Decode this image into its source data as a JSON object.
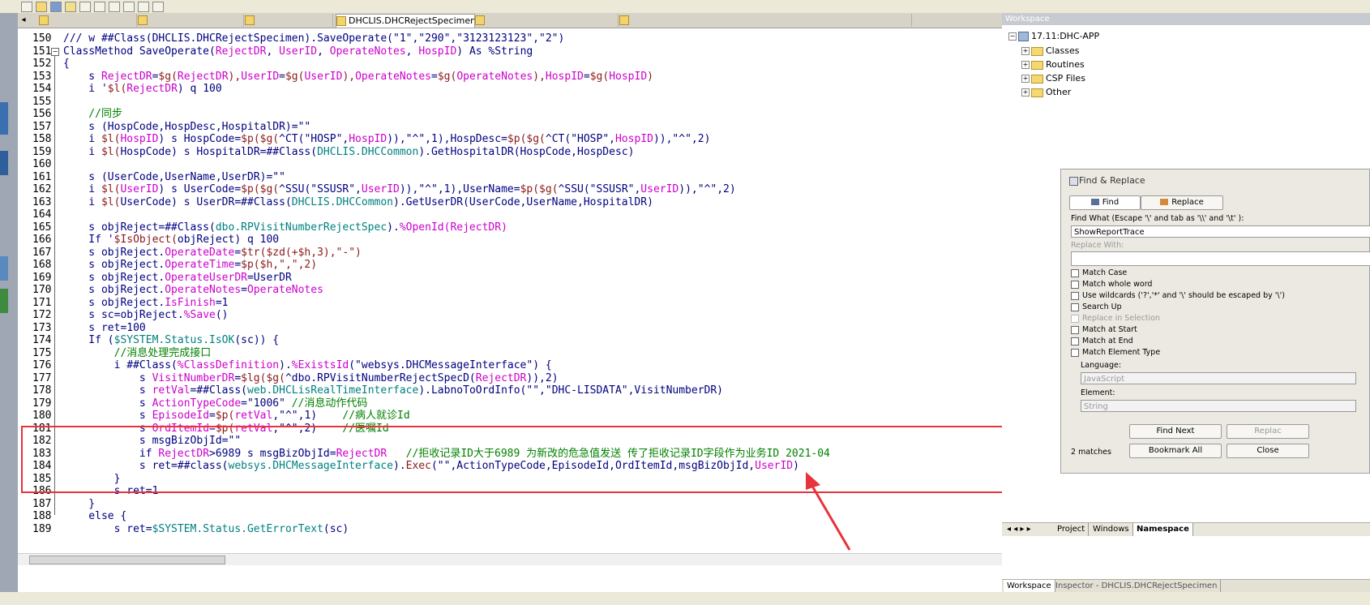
{
  "editor": {
    "tabs": [
      "",
      "",
      "",
      "DHCLIS.DHCRejectSpecimen.cls",
      "",
      ""
    ],
    "tab_arrows": "▸ ×",
    "lines": [
      {
        "n": "150",
        "segs": [
          [
            "/// w ##Class(DHCLIS.DHCRejectSpecimen).SaveOperate(\"1\",\"290\",\"3123123123\",\"2\")",
            "kw"
          ]
        ]
      },
      {
        "n": "151",
        "segs": [
          [
            "ClassMethod SaveOperate(",
            "kw"
          ],
          [
            "RejectDR",
            "var"
          ],
          [
            ", ",
            "kw"
          ],
          [
            "UserID",
            "var"
          ],
          [
            ", ",
            "kw"
          ],
          [
            "OperateNotes",
            "var"
          ],
          [
            ", ",
            "kw"
          ],
          [
            "HospID",
            "var"
          ],
          [
            ") As %String",
            "kw"
          ]
        ]
      },
      {
        "n": "152",
        "segs": [
          [
            "{",
            "kw"
          ]
        ]
      },
      {
        "n": "153",
        "segs": [
          [
            "    s ",
            "kw"
          ],
          [
            "RejectDR",
            "var"
          ],
          [
            "=",
            "kw"
          ],
          [
            "$g(",
            "fn"
          ],
          [
            "RejectDR",
            "var"
          ],
          [
            "),",
            "fn"
          ],
          [
            "UserID",
            "var"
          ],
          [
            "=",
            "kw"
          ],
          [
            "$g(",
            "fn"
          ],
          [
            "UserID",
            "var"
          ],
          [
            "),",
            "fn"
          ],
          [
            "OperateNotes",
            "var"
          ],
          [
            "=",
            "kw"
          ],
          [
            "$g(",
            "fn"
          ],
          [
            "OperateNotes",
            "var"
          ],
          [
            "),",
            "fn"
          ],
          [
            "HospID",
            "var"
          ],
          [
            "=",
            "kw"
          ],
          [
            "$g(",
            "fn"
          ],
          [
            "HospID",
            "var"
          ],
          [
            ")",
            "fn"
          ]
        ]
      },
      {
        "n": "154",
        "segs": [
          [
            "    i '",
            "kw"
          ],
          [
            "$l(",
            "fn"
          ],
          [
            "RejectDR",
            "var"
          ],
          [
            ") q 100",
            "kw"
          ]
        ]
      },
      {
        "n": "155",
        "segs": [
          [
            "",
            "kw"
          ]
        ]
      },
      {
        "n": "156",
        "segs": [
          [
            "    //同步",
            "cmt"
          ]
        ]
      },
      {
        "n": "157",
        "segs": [
          [
            "    s (HospCode,HospDesc,HospitalDR)=\"\"",
            "kw"
          ]
        ]
      },
      {
        "n": "158",
        "segs": [
          [
            "    i ",
            "kw"
          ],
          [
            "$l(",
            "fn"
          ],
          [
            "HospID",
            "var"
          ],
          [
            ") s HospCode=",
            "kw"
          ],
          [
            "$p($g(",
            "fn"
          ],
          [
            "^CT(\"HOSP\",",
            "kw"
          ],
          [
            "HospID",
            "var"
          ],
          [
            ")),\"^\",1),HospDesc=",
            "kw"
          ],
          [
            "$p($g(",
            "fn"
          ],
          [
            "^CT(\"HOSP\",",
            "kw"
          ],
          [
            "HospID",
            "var"
          ],
          [
            ")),\"^\",2)",
            "kw"
          ]
        ]
      },
      {
        "n": "159",
        "segs": [
          [
            "    i ",
            "kw"
          ],
          [
            "$l(",
            "fn"
          ],
          [
            "HospCode) s HospitalDR=##Class(",
            "kw"
          ],
          [
            "DHCLIS.DHCCommon",
            "cls"
          ],
          [
            ").GetHospitalDR(HospCode,HospDesc)",
            "kw"
          ]
        ]
      },
      {
        "n": "160",
        "segs": [
          [
            "",
            "kw"
          ]
        ]
      },
      {
        "n": "161",
        "segs": [
          [
            "    s (UserCode,UserName,UserDR)=\"\"",
            "kw"
          ]
        ]
      },
      {
        "n": "162",
        "segs": [
          [
            "    i ",
            "kw"
          ],
          [
            "$l(",
            "fn"
          ],
          [
            "UserID",
            "var"
          ],
          [
            ") s UserCode=",
            "kw"
          ],
          [
            "$p($g(",
            "fn"
          ],
          [
            "^SSU(\"SSUSR\",",
            "kw"
          ],
          [
            "UserID",
            "var"
          ],
          [
            ")),\"^\",1),UserName=",
            "kw"
          ],
          [
            "$p($g(",
            "fn"
          ],
          [
            "^SSU(\"SSUSR\",",
            "kw"
          ],
          [
            "UserID",
            "var"
          ],
          [
            ")),\"^\",2)",
            "kw"
          ]
        ]
      },
      {
        "n": "163",
        "segs": [
          [
            "    i ",
            "kw"
          ],
          [
            "$l(",
            "fn"
          ],
          [
            "UserCode) s UserDR=##Class(",
            "kw"
          ],
          [
            "DHCLIS.DHCCommon",
            "cls"
          ],
          [
            ").GetUserDR(UserCode,UserName,HospitalDR)",
            "kw"
          ]
        ]
      },
      {
        "n": "164",
        "segs": [
          [
            "",
            "kw"
          ]
        ]
      },
      {
        "n": "165",
        "segs": [
          [
            "    s objReject=##Class(",
            "kw"
          ],
          [
            "dbo.RPVisitNumberRejectSpec",
            "cls"
          ],
          [
            ").",
            "kw"
          ],
          [
            "%OpenId(",
            "var"
          ],
          [
            "RejectDR",
            "var"
          ],
          [
            ")",
            "var"
          ]
        ]
      },
      {
        "n": "166",
        "segs": [
          [
            "    If '",
            "kw"
          ],
          [
            "$IsObject(",
            "fn"
          ],
          [
            "objReject) q 100",
            "kw"
          ]
        ]
      },
      {
        "n": "167",
        "segs": [
          [
            "    s objReject.",
            "kw"
          ],
          [
            "OperateDate",
            "var"
          ],
          [
            "=",
            "kw"
          ],
          [
            "$tr($zd(+$h,3),\"-\")",
            "fn"
          ]
        ]
      },
      {
        "n": "168",
        "segs": [
          [
            "    s objReject.",
            "kw"
          ],
          [
            "OperateTime",
            "var"
          ],
          [
            "=",
            "kw"
          ],
          [
            "$p($h,\",\",2)",
            "fn"
          ]
        ]
      },
      {
        "n": "169",
        "segs": [
          [
            "    s objReject.",
            "kw"
          ],
          [
            "OperateUserDR",
            "var"
          ],
          [
            "=UserDR",
            "kw"
          ]
        ]
      },
      {
        "n": "170",
        "segs": [
          [
            "    s objReject.",
            "kw"
          ],
          [
            "OperateNotes",
            "var"
          ],
          [
            "=",
            "kw"
          ],
          [
            "OperateNotes",
            "var"
          ]
        ]
      },
      {
        "n": "171",
        "segs": [
          [
            "    s objReject.",
            "kw"
          ],
          [
            "IsFinish",
            "var"
          ],
          [
            "=1",
            "kw"
          ]
        ]
      },
      {
        "n": "172",
        "segs": [
          [
            "    s sc=objReject.",
            "kw"
          ],
          [
            "%Save",
            "var"
          ],
          [
            "()",
            "kw"
          ]
        ]
      },
      {
        "n": "173",
        "segs": [
          [
            "    s ret=100",
            "kw"
          ]
        ]
      },
      {
        "n": "174",
        "segs": [
          [
            "    If (",
            "kw"
          ],
          [
            "$SYSTEM.Status.IsOK",
            "cls"
          ],
          [
            "(sc)) {",
            "kw"
          ]
        ]
      },
      {
        "n": "175",
        "segs": [
          [
            "        //消息处理完成接口",
            "cmt"
          ]
        ]
      },
      {
        "n": "176",
        "segs": [
          [
            "        i ##Class(",
            "kw"
          ],
          [
            "%ClassDefinition",
            "var"
          ],
          [
            ").",
            "kw"
          ],
          [
            "%ExistsId",
            "var"
          ],
          [
            "(\"websys.DHCMessageInterface\") {",
            "kw"
          ]
        ]
      },
      {
        "n": "177",
        "segs": [
          [
            "            s ",
            "kw"
          ],
          [
            "VisitNumberDR",
            "var"
          ],
          [
            "=",
            "kw"
          ],
          [
            "$lg($g(",
            "fn"
          ],
          [
            "^dbo.RPVisitNumberRejectSpecD(",
            "kw"
          ],
          [
            "RejectDR",
            "var"
          ],
          [
            ")),2)",
            "kw"
          ]
        ]
      },
      {
        "n": "178",
        "segs": [
          [
            "            s ",
            "kw"
          ],
          [
            "retVal",
            "var"
          ],
          [
            "=##Class(",
            "kw"
          ],
          [
            "web.DHCLisRealTimeInterface",
            "cls"
          ],
          [
            ").LabnoToOrdInfo(\"\",\"DHC-LISDATA\",VisitNumberDR)",
            "kw"
          ]
        ]
      },
      {
        "n": "179",
        "segs": [
          [
            "            s ",
            "kw"
          ],
          [
            "ActionTypeCode",
            "var"
          ],
          [
            "=\"1006\" ",
            "kw"
          ],
          [
            "//消息动作代码",
            "cmt"
          ]
        ]
      },
      {
        "n": "180",
        "segs": [
          [
            "            s ",
            "kw"
          ],
          [
            "EpisodeId",
            "var"
          ],
          [
            "=",
            "kw"
          ],
          [
            "$p(",
            "fn"
          ],
          [
            "retVal",
            "var"
          ],
          [
            ",\"^\",1)    ",
            "kw"
          ],
          [
            "//病人就诊Id",
            "cmt"
          ]
        ]
      },
      {
        "n": "181",
        "segs": [
          [
            "            s ",
            "kw"
          ],
          [
            "OrdItemId",
            "var"
          ],
          [
            "=",
            "kw"
          ],
          [
            "$p(",
            "fn"
          ],
          [
            "retVal",
            "var"
          ],
          [
            ",\"^\",2)    ",
            "kw"
          ],
          [
            "//医嘱Id",
            "cmt"
          ]
        ]
      },
      {
        "n": "182",
        "segs": [
          [
            "            s msgBizObjId=\"\"",
            "kw"
          ]
        ]
      },
      {
        "n": "183",
        "segs": [
          [
            "            if ",
            "kw"
          ],
          [
            "RejectDR",
            "var"
          ],
          [
            ">6989 s msgBizObjId=",
            "kw"
          ],
          [
            "RejectDR",
            "var"
          ],
          [
            "   ",
            "kw"
          ],
          [
            "//拒收记录ID大于6989 为新改的危急值发送 传了拒收记录ID字段作为业务ID 2021-04",
            "cmt"
          ]
        ]
      },
      {
        "n": "184",
        "segs": [
          [
            "            s ret=##class(",
            "kw"
          ],
          [
            "websys.DHCMessageInterface",
            "cls"
          ],
          [
            ").",
            "kw"
          ],
          [
            "Exec",
            "fn"
          ],
          [
            "(\"\",ActionTypeCode,EpisodeId,OrdItemId,msgBizObjId,",
            "kw"
          ],
          [
            "UserID",
            "var"
          ],
          [
            ")",
            "kw"
          ]
        ]
      },
      {
        "n": "185",
        "segs": [
          [
            "        }",
            "kw"
          ]
        ]
      },
      {
        "n": "186",
        "segs": [
          [
            "        s ret=1",
            "kw"
          ]
        ]
      },
      {
        "n": "187",
        "segs": [
          [
            "    }",
            "kw"
          ]
        ]
      },
      {
        "n": "188",
        "segs": [
          [
            "    else {",
            "kw"
          ]
        ]
      },
      {
        "n": "189",
        "segs": [
          [
            "        s ret=",
            "kw"
          ],
          [
            "$SYSTEM.Status.GetErrorText",
            "cls"
          ],
          [
            "(sc)",
            "kw"
          ]
        ]
      }
    ]
  },
  "workspace": {
    "title": "Workspace",
    "root": "17.11:DHC-APP",
    "items": [
      "Classes",
      "Routines",
      "CSP Files",
      "Other"
    ],
    "nav_arrows": "◂ ◂ ▸ ▸",
    "tabs": [
      "Project",
      "Windows",
      "Namespace"
    ],
    "bottom_tabs": [
      "Workspace",
      "Inspector - DHCLIS.DHCRejectSpecimen"
    ]
  },
  "find_replace": {
    "title": "Find & Replace",
    "tab_find": "Find",
    "tab_replace": "Replace",
    "find_what_label": "Find What (Escape '\\' and tab as '\\\\' and '\\t' ):",
    "find_what_value": "ShowReportTrace",
    "replace_with_label": "Replace With:",
    "replace_with_value": "",
    "options": [
      {
        "label": "Match Case",
        "enabled": true
      },
      {
        "label": "Match whole word",
        "enabled": true
      },
      {
        "label": "Use wildcards ('?','*' and '\\' should be escaped by '\\')",
        "enabled": true
      },
      {
        "label": "Search Up",
        "enabled": true
      },
      {
        "label": "Replace in Selection",
        "enabled": false
      },
      {
        "label": "Match at Start",
        "enabled": true
      },
      {
        "label": "Match at End",
        "enabled": true
      },
      {
        "label": "Match Element Type",
        "enabled": true
      }
    ],
    "language_label": "Language:",
    "language_value": "JavaScript",
    "element_label": "Element:",
    "element_value": "String",
    "find_next": "Find Next",
    "replace_btn": "Replac",
    "bookmark_all": "Bookmark All",
    "close_btn": "Close",
    "matches": "2 matches"
  },
  "colors": {
    "highlight_box": "#e8323c",
    "keyword": "#000080",
    "variable": "#cc00cc",
    "comment": "#008000"
  }
}
